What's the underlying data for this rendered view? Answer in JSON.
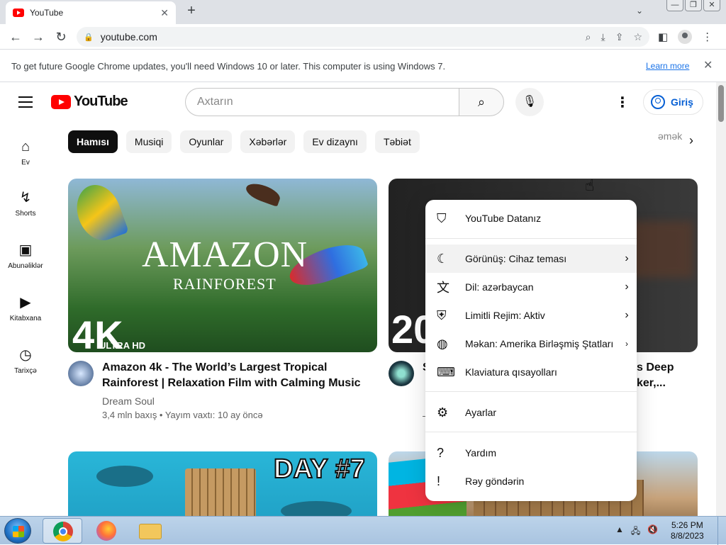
{
  "browser": {
    "tab_title": "YouTube",
    "tab_close": "✕",
    "new_tab": "+",
    "tab_search": "⌄",
    "window_buttons": [
      "—",
      "❐",
      "✕"
    ],
    "url": "youtube.com",
    "infobar_message": "To get future Google Chrome updates, you'll need Windows 10 or later. This computer is using Windows 7.",
    "infobar_link": "Learn more",
    "infobar_close": "✕"
  },
  "youtube": {
    "logo_text": "YouTube",
    "search_placeholder": "Axtarın",
    "sign_in": "Giriş",
    "guide": [
      {
        "icon": "home-icon",
        "glyph": "⌂",
        "label": "Ev"
      },
      {
        "icon": "shorts-icon",
        "glyph": "↯",
        "label": "Shorts"
      },
      {
        "icon": "subscriptions-icon",
        "glyph": "▣",
        "label": "Abunəliklər"
      },
      {
        "icon": "library-icon",
        "glyph": "▶",
        "label": "Kitabxana"
      },
      {
        "icon": "history-icon",
        "glyph": "◷",
        "label": "Tarixçə"
      }
    ],
    "chips": [
      "Hamısı",
      "Musiqi",
      "Oyunlar",
      "Xəbərlər",
      "Ev dizaynı",
      "Təbiət"
    ],
    "chip_partial": "əmək",
    "videos": [
      {
        "thumb_title": "AMAZON",
        "thumb_subtitle": "RAINFOREST",
        "thumb_badge": "4K",
        "thumb_badge_sub": "ULTRA HD",
        "title": "Amazon 4k - The World’s Largest Tropical Rainforest | Relaxation Film with Calming Music",
        "channel": "Dream Soul",
        "stats": "3,4 mln baxış • Yayım vaxtı: 10 ay öncə"
      },
      {
        "thumb_badge": "20",
        "title_fragment_1": "s Deep",
        "title_fragment_2": "ker,...",
        "title_start": "S",
        "channel_start": "—"
      },
      {
        "thumb_text": "DAY #7"
      },
      {}
    ]
  },
  "settings_menu": {
    "items": [
      {
        "icon": "shield-person-icon",
        "glyph": "⛉",
        "label": "YouTube Datanız",
        "chevron": ""
      },
      {
        "icon": "moon-icon",
        "glyph": "☾",
        "label": "Görünüş: Cihaz teması",
        "chevron": "›"
      },
      {
        "icon": "translate-icon",
        "glyph": "文",
        "label": "Dil: azərbaycan",
        "chevron": "›"
      },
      {
        "icon": "restricted-mode-icon",
        "glyph": "⛨",
        "label": "Limitli Rejim: Aktiv",
        "chevron": "›"
      },
      {
        "icon": "globe-icon",
        "glyph": "◍",
        "label": "Məkan: Amerika Birləşmiş Ştatları",
        "chevron": "›"
      },
      {
        "icon": "keyboard-icon",
        "glyph": "⌨",
        "label": "Klaviatura qısayolları",
        "chevron": ""
      },
      {
        "icon": "gear-icon",
        "glyph": "⚙",
        "label": "Ayarlar",
        "chevron": ""
      },
      {
        "icon": "help-icon",
        "glyph": "?",
        "label": "Yardım",
        "chevron": ""
      },
      {
        "icon": "feedback-icon",
        "glyph": "!",
        "label": "Rəy göndərin",
        "chevron": ""
      }
    ]
  },
  "taskbar": {
    "time": "5:26 PM",
    "date": "8/8/2023"
  }
}
